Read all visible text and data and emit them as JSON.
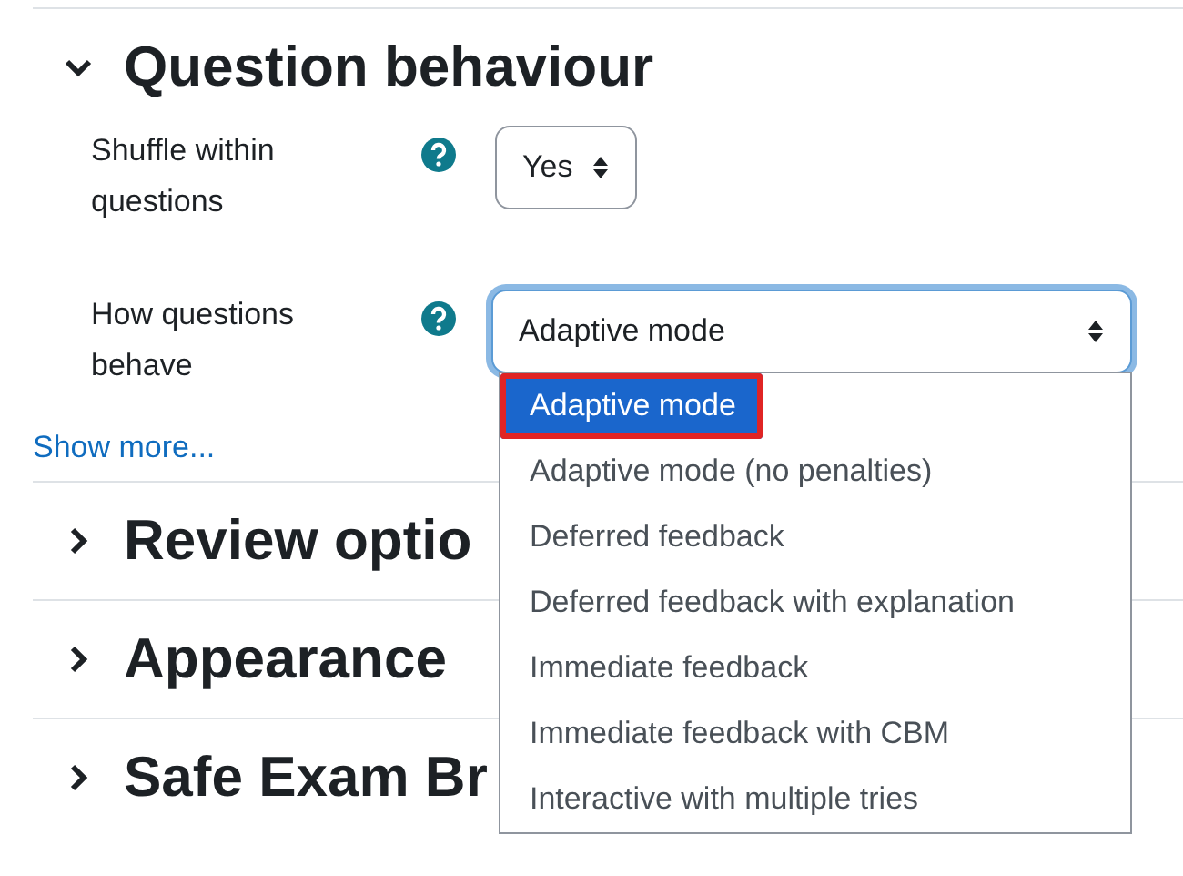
{
  "sections": [
    {
      "title": "Question behaviour",
      "expanded": true,
      "fields": [
        {
          "label": "Shuffle within questions",
          "value": "Yes"
        },
        {
          "label": "How questions behave",
          "value": "Adaptive mode",
          "focused": true,
          "options": [
            {
              "label": "Adaptive mode",
              "selected": true,
              "highlighted": true
            },
            {
              "label": "Adaptive mode (no penalties)",
              "selected": false,
              "highlighted": false
            },
            {
              "label": "Deferred feedback",
              "selected": false,
              "highlighted": false
            },
            {
              "label": "Deferred feedback with explanation",
              "selected": false,
              "highlighted": false
            },
            {
              "label": "Immediate feedback",
              "selected": false,
              "highlighted": false
            },
            {
              "label": "Immediate feedback with CBM",
              "selected": false,
              "highlighted": false
            },
            {
              "label": "Interactive with multiple tries",
              "selected": false,
              "highlighted": false
            }
          ]
        }
      ],
      "link": "Show more..."
    },
    {
      "title": "Review optio",
      "expanded": false
    },
    {
      "title": "Appearance",
      "expanded": false
    },
    {
      "title": "Safe Exam Br",
      "expanded": false
    }
  ]
}
